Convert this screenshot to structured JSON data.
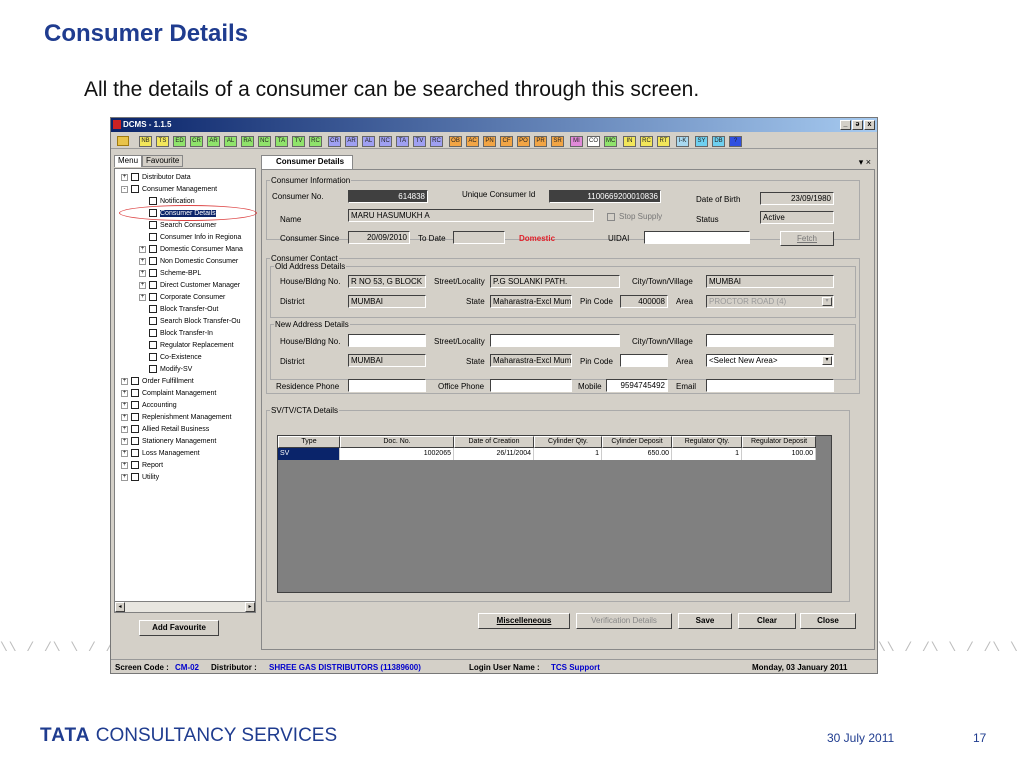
{
  "slide": {
    "title": "Consumer Details",
    "subtitle": "All the details of a consumer can be searched through this screen.",
    "footer_logo_tata": "TATA",
    "footer_logo_cs": "CONSULTANCY SERVICES",
    "footer_date": "30 July 2011",
    "footer_page": "17",
    "deco_pattern": "\\\\ / /\\ \\ / /\\ \\ /"
  },
  "window": {
    "title": "DCMS - 1.1.5",
    "buttons": [
      "_",
      "ə",
      "x"
    ]
  },
  "toolbar": {
    "buttons": [
      {
        "label": "NB",
        "color": "#f2e65a"
      },
      {
        "label": "TS",
        "color": "#f2e65a"
      },
      {
        "label": "ED",
        "color": "#8fe36b"
      },
      {
        "label": "CR",
        "color": "#8fe36b"
      },
      {
        "label": "AR",
        "color": "#8fe36b"
      },
      {
        "label": "AL",
        "color": "#8fe36b"
      },
      {
        "label": "RA",
        "color": "#8fe36b"
      },
      {
        "label": "NC",
        "color": "#8fe36b"
      },
      {
        "label": "TA",
        "color": "#8fe36b"
      },
      {
        "label": "TV",
        "color": "#8fe36b"
      },
      {
        "label": "RC",
        "color": "#8fe36b"
      },
      {
        "label": "CR",
        "color": "#9fa0f2"
      },
      {
        "label": "AR",
        "color": "#9fa0f2"
      },
      {
        "label": "AL",
        "color": "#9fa0f2"
      },
      {
        "label": "NC",
        "color": "#9fa0f2"
      },
      {
        "label": "TA",
        "color": "#9fa0f2"
      },
      {
        "label": "TV",
        "color": "#9fa0f2"
      },
      {
        "label": "RC",
        "color": "#9fa0f2"
      },
      {
        "label": "OB",
        "color": "#f2a545"
      },
      {
        "label": "AC",
        "color": "#f2a545"
      },
      {
        "label": "PN",
        "color": "#f2a545"
      },
      {
        "label": "CF",
        "color": "#f2a545"
      },
      {
        "label": "PO",
        "color": "#f2a545"
      },
      {
        "label": "PR",
        "color": "#f2a545"
      },
      {
        "label": "SR",
        "color": "#f2a545"
      },
      {
        "label": "MI",
        "color": "#e08ad8"
      },
      {
        "label": "CO",
        "color": "#ffffff"
      },
      {
        "label": "MC",
        "color": "#8fe36b"
      },
      {
        "label": "IN",
        "color": "#f2e65a"
      },
      {
        "label": "RC",
        "color": "#f2e65a"
      },
      {
        "label": "RT",
        "color": "#f2e65a"
      },
      {
        "label": "I-K",
        "color": "#a8d8f0"
      },
      {
        "label": "SY",
        "color": "#6fd0f0"
      },
      {
        "label": "DB",
        "color": "#6fd0f0"
      },
      {
        "label": "?",
        "color": "#3050e0"
      }
    ]
  },
  "left_tabs": [
    "Menu",
    "Favourite"
  ],
  "tree": [
    {
      "label": "Distributor Data",
      "pm": "+",
      "indent": 0
    },
    {
      "label": "Consumer Management",
      "pm": "-",
      "indent": 0
    },
    {
      "label": "Notification",
      "pm": "",
      "indent": 1
    },
    {
      "label": "Consumer Details",
      "pm": "",
      "indent": 1,
      "selected": true
    },
    {
      "label": "Search Consumer",
      "pm": "",
      "indent": 1
    },
    {
      "label": "Consumer Info in Regiona",
      "pm": "",
      "indent": 1
    },
    {
      "label": "Domestic Consumer Mana",
      "pm": "+",
      "indent": 1
    },
    {
      "label": "Non Domestic Consumer",
      "pm": "+",
      "indent": 1
    },
    {
      "label": "Scheme-BPL",
      "pm": "+",
      "indent": 1
    },
    {
      "label": "Direct Customer Manager",
      "pm": "+",
      "indent": 1
    },
    {
      "label": "Corporate Consumer",
      "pm": "+",
      "indent": 1
    },
    {
      "label": "Block Transfer-Out",
      "pm": "",
      "indent": 1
    },
    {
      "label": "Search Block Transfer-Ou",
      "pm": "",
      "indent": 1
    },
    {
      "label": "Block Transfer-In",
      "pm": "",
      "indent": 1
    },
    {
      "label": "Regulator Replacement",
      "pm": "",
      "indent": 1
    },
    {
      "label": "Co-Existence",
      "pm": "",
      "indent": 1
    },
    {
      "label": "Modify-SV",
      "pm": "",
      "indent": 1
    },
    {
      "label": "Order Fulfillment",
      "pm": "+",
      "indent": 0
    },
    {
      "label": "Complaint Management",
      "pm": "+",
      "indent": 0
    },
    {
      "label": "Accounting",
      "pm": "+",
      "indent": 0
    },
    {
      "label": "Replenishment Management",
      "pm": "+",
      "indent": 0
    },
    {
      "label": "Allied Retail Business",
      "pm": "+",
      "indent": 0
    },
    {
      "label": "Stationery Management",
      "pm": "+",
      "indent": 0
    },
    {
      "label": "Loss Management",
      "pm": "+",
      "indent": 0
    },
    {
      "label": "Report",
      "pm": "+",
      "indent": 0
    },
    {
      "label": "Utility",
      "pm": "+",
      "indent": 0
    }
  ],
  "add_favourite": "Add Favourite",
  "content_tab": "Consumer Details",
  "content_tab_controls": "▾ ×",
  "consumer_info": {
    "legend": "Consumer Information",
    "consumer_no_label": "Consumer No.",
    "consumer_no": "614838",
    "unique_id_label": "Unique Consumer Id",
    "unique_id": "1100669200010836",
    "dob_label": "Date of Birth",
    "dob": "23/09/1980",
    "name_label": "Name",
    "name": "MARU HASUMUKH A",
    "stop_supply": "Stop Supply",
    "status_label": "Status",
    "status": "Active",
    "since_label": "Consumer Since",
    "since": "20/09/2010",
    "to_date_label": "To Date",
    "domestic": "Domestic",
    "uidai_label": "UIDAI",
    "fetch": "Fetch"
  },
  "contact": {
    "legend": "Consumer Contact",
    "old_legend": "Old Address Details",
    "house_label": "House/Bldng No.",
    "old_house": "R NO 53, G BLOCK ,",
    "street_label": "Street/Locality",
    "old_street": "P.G SOLANKI PATH.",
    "city_label": "City/Town/Village",
    "old_city": "MUMBAI",
    "district_label": "District",
    "old_district": "MUMBAI",
    "state_label": "State",
    "old_state": "Maharastra-Excl Mum",
    "pin_label": "Pin Code",
    "old_pin": "400008",
    "area_label": "Area",
    "old_area": "PROCTOR ROAD (4)",
    "new_legend": "New Address Details",
    "new_district": "MUMBAI",
    "new_state": "Maharastra-Excl Mum",
    "new_area": "<Select New Area>",
    "res_phone_label": "Residence Phone",
    "office_phone_label": "Office Phone",
    "mobile_label": "Mobile",
    "mobile": "9594745492",
    "email_label": "Email"
  },
  "sv": {
    "legend": "SV/TV/CTA Details",
    "headers": [
      "Type",
      "Doc. No.",
      "Date of Creation",
      "Cylinder Qty.",
      "Cylinder Deposit",
      "Regulator Qty.",
      "Regulator Deposit"
    ],
    "rows": [
      [
        "SV",
        "1002065",
        "26/11/2004",
        "1",
        "650.00",
        "1",
        "100.00"
      ]
    ]
  },
  "actions": {
    "misc": "Miscelleneous",
    "verify": "Verification Details",
    "save": "Save",
    "clear": "Clear",
    "close": "Close"
  },
  "status": {
    "screen_code_label": "Screen Code :",
    "screen_code": "CM-02",
    "distributor_label": "Distributor :",
    "distributor": "SHREE GAS DISTRIBUTORS (11389600)",
    "login_label": "Login User Name :",
    "login": "TCS Support",
    "date": "Monday, 03 January 2011"
  }
}
